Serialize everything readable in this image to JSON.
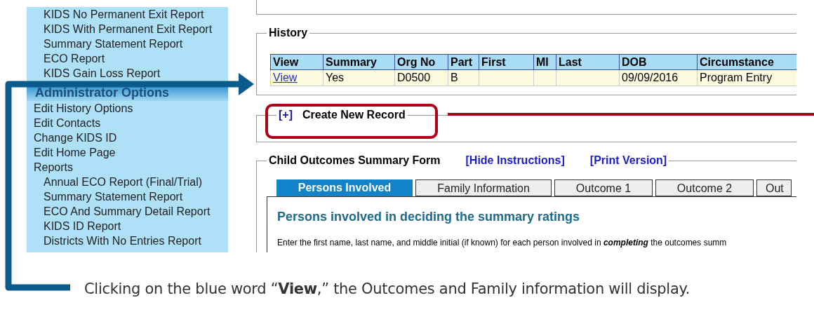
{
  "sidebar": {
    "report_items": [
      "KIDS No Permanent Exit Report",
      "KIDS With Permanent Exit Report",
      "Summary Statement Report",
      "ECO Report",
      "KIDS Gain Loss Report"
    ],
    "section_title": "Administrator Options",
    "admin_items": [
      {
        "label": "Edit History Options"
      },
      {
        "label": "Edit Contacts"
      },
      {
        "label": "Change KIDS ID"
      },
      {
        "label": "Edit Home Page"
      },
      {
        "label": "Reports",
        "children": [
          {
            "label": "Annual ECO Report (Final/Trial)"
          },
          {
            "label": "Summary Statement Report"
          },
          {
            "label": "ECO And Summary Detail Report"
          },
          {
            "label": "KIDS ID Report"
          },
          {
            "label": "Districts With No Entries Report"
          }
        ]
      }
    ]
  },
  "history": {
    "legend": "History",
    "columns": [
      "View",
      "Summary",
      "Org No",
      "Part",
      "First",
      "MI",
      "Last",
      "DOB",
      "Circumstance"
    ],
    "rows": [
      {
        "cells": [
          {
            "kind": "link",
            "text": "View"
          },
          {
            "kind": "text",
            "text": "Yes"
          },
          {
            "kind": "text",
            "text": "D0500"
          },
          {
            "kind": "text",
            "text": "B"
          },
          {
            "kind": "text",
            "text": ""
          },
          {
            "kind": "text",
            "text": ""
          },
          {
            "kind": "text",
            "text": ""
          },
          {
            "kind": "text",
            "text": "09/09/2016"
          },
          {
            "kind": "text",
            "text": "Program Entry"
          }
        ]
      }
    ]
  },
  "create_record": {
    "toggle": "[+]",
    "label": "Create New Record"
  },
  "form": {
    "legend": "Child Outcomes Summary Form",
    "links": [
      "[Hide Instructions]",
      "[Print Version]"
    ],
    "tabs": [
      {
        "label": "Persons Involved",
        "selected": true
      },
      {
        "label": "Family Information",
        "selected": false
      },
      {
        "label": "Outcome 1",
        "selected": false
      },
      {
        "label": "Outcome 2",
        "selected": false
      },
      {
        "label": "Out",
        "selected": false
      }
    ],
    "heading": "Persons involved in deciding the summary ratings",
    "instructions": "Enter the first name, last name, and middle initial (if known) for each person involved in **completing** the outcomes summ"
  },
  "caption": "Clicking on the blue word “**View**,” the Outcomes and Family information will display."
}
